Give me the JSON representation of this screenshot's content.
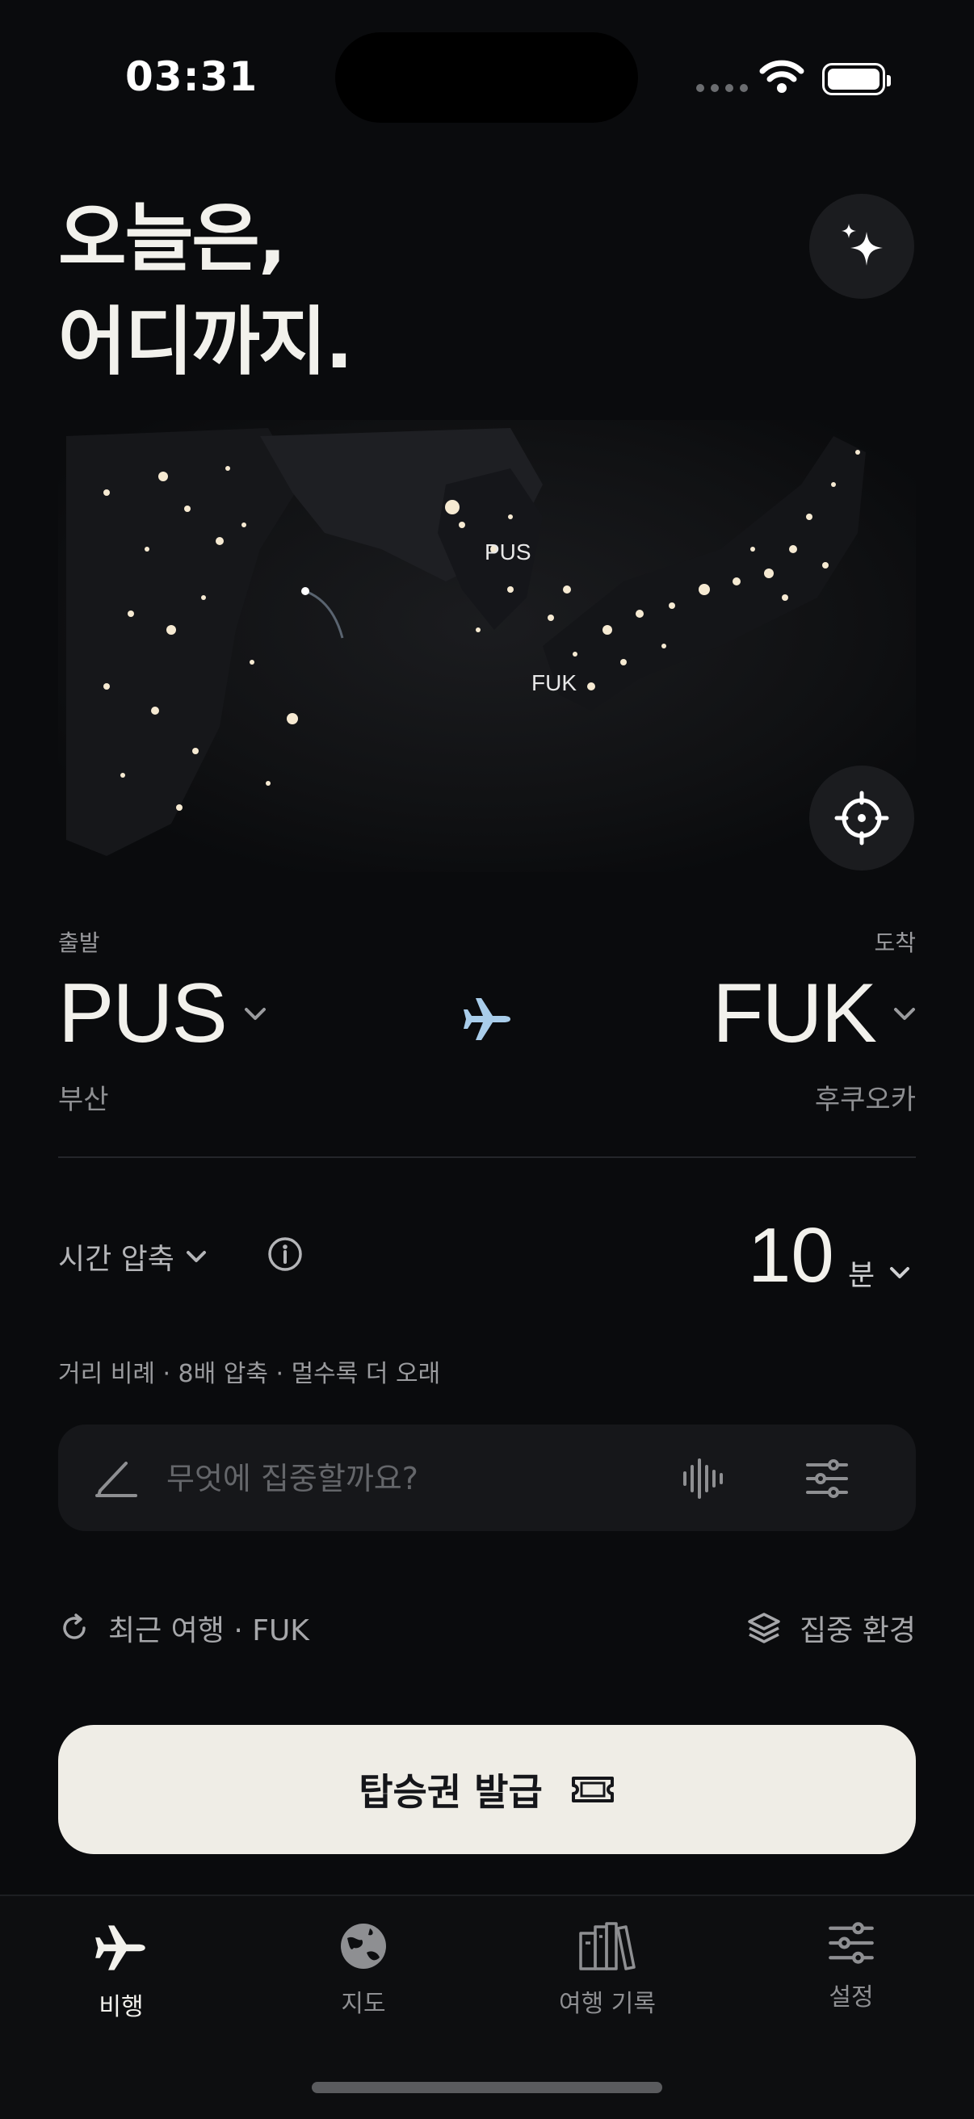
{
  "status_bar": {
    "time": "03:31"
  },
  "header": {
    "line1": "오늘은,",
    "line2": "어디까지."
  },
  "map": {
    "origin_label": "PUS",
    "dest_label": "FUK"
  },
  "route": {
    "departure_label": "출발",
    "arrival_label": "도착",
    "origin_code": "PUS",
    "origin_city": "부산",
    "dest_code": "FUK",
    "dest_city": "후쿠오카"
  },
  "compression": {
    "label": "시간 압축",
    "minutes": "10",
    "unit": "분",
    "description": "거리 비례 · 8배 압축 · 멀수록 더 오래"
  },
  "focus_input": {
    "placeholder": "무엇에 집중할까요?"
  },
  "recent": {
    "label": "최근 여행 · FUK"
  },
  "focus_env": {
    "label": "집중 환경"
  },
  "primary_button": {
    "label": "탑승권 발급"
  },
  "tabs": [
    {
      "label": "비행",
      "icon": "airplane-icon",
      "active": true
    },
    {
      "label": "지도",
      "icon": "globe-icon",
      "active": false
    },
    {
      "label": "여행 기록",
      "icon": "books-icon",
      "active": false
    },
    {
      "label": "설정",
      "icon": "sliders-icon",
      "active": false
    }
  ],
  "colors": {
    "background": "#0a0b0d",
    "accent_plane": "#a9cdea",
    "button": "#efede6"
  }
}
